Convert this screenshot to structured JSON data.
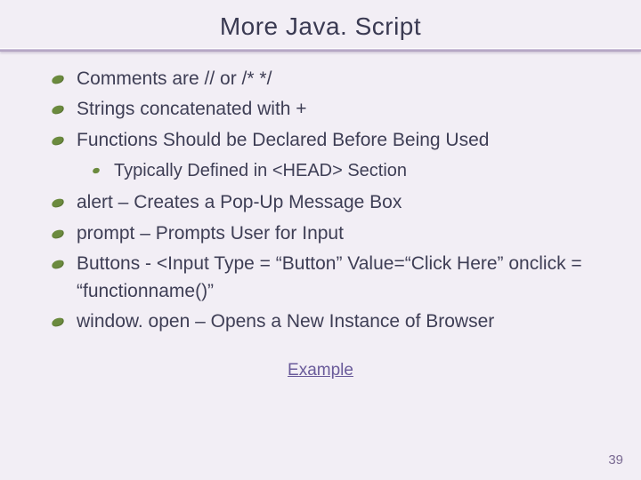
{
  "title": "More Java. Script",
  "bullets": {
    "b1": "Comments are // or  /*  */",
    "b2": "Strings concatenated with +",
    "b3": "Functions Should be Declared Before Being Used",
    "b3_sub1": "Typically Defined in <HEAD> Section",
    "b4": "alert – Creates a Pop-Up Message Box",
    "b5": "prompt – Prompts User for Input",
    "b6": "Buttons - <Input Type = “Button” Value=“Click Here” onclick = “functionname()”",
    "b7": "window. open – Opens a New Instance of Browser"
  },
  "example_link": "Example",
  "page_number": "39"
}
